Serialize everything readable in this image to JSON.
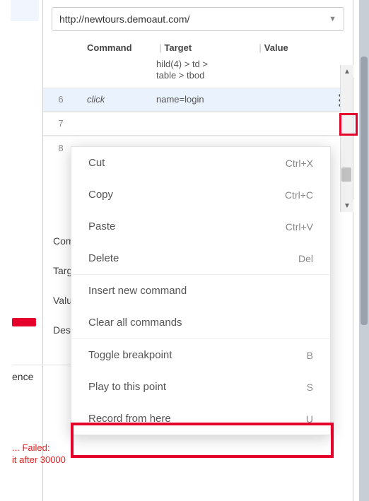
{
  "url_bar": {
    "value": "http://newtours.demoaut.com/"
  },
  "columns": {
    "num": "",
    "command": "Command",
    "target": "Target",
    "value": "Value"
  },
  "fragment_row": {
    "target_line1": "hild(4) > td >",
    "target_line2": "table > tbod"
  },
  "steps": [
    {
      "num": "6",
      "command": "click",
      "target": "name=login",
      "selected": true
    },
    {
      "num": "7",
      "command": "",
      "target": ""
    },
    {
      "num": "8",
      "command": "",
      "target": ""
    }
  ],
  "form_labels": {
    "command": "Com",
    "target": "Targ",
    "value": "Valu",
    "description": "Desc"
  },
  "footer_label": "ence",
  "error_text": "... Failed:\nit after 30000",
  "context_menu": {
    "items": [
      {
        "label": "Cut",
        "shortcut": "Ctrl+X"
      },
      {
        "label": "Copy",
        "shortcut": "Ctrl+C"
      },
      {
        "label": "Paste",
        "shortcut": "Ctrl+V"
      },
      {
        "label": "Delete",
        "shortcut": "Del"
      }
    ],
    "items2": [
      {
        "label": "Insert new command",
        "shortcut": ""
      },
      {
        "label": "Clear all commands",
        "shortcut": ""
      }
    ],
    "items3": [
      {
        "label": "Toggle breakpoint",
        "shortcut": "B"
      },
      {
        "label": "Play to this point",
        "shortcut": "S"
      },
      {
        "label": "Record from here",
        "shortcut": "U"
      }
    ]
  }
}
